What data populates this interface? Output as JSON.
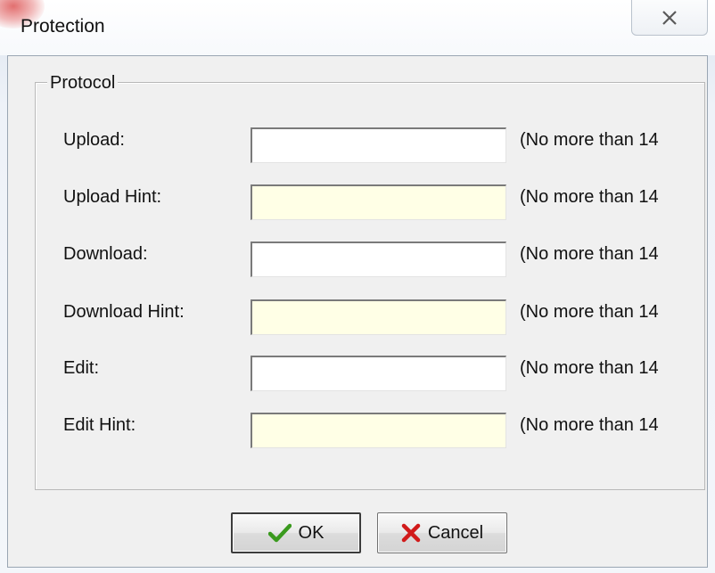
{
  "window": {
    "title": "Protection",
    "close_glyph": "✕"
  },
  "group": {
    "title": "Protocol"
  },
  "rows": [
    {
      "label": "Upload:",
      "value": "",
      "note": "(No more than 14"
    },
    {
      "label": "Upload Hint:",
      "value": "",
      "note": "(No more than 14"
    },
    {
      "label": "Download:",
      "value": "",
      "note": "(No more than 14"
    },
    {
      "label": "Download Hint:",
      "value": "",
      "note": "(No more than 14"
    },
    {
      "label": "Edit:",
      "value": "",
      "note": "(No more than 14"
    },
    {
      "label": "Edit Hint:",
      "value": "",
      "note": "(No more than 14"
    }
  ],
  "buttons": {
    "ok_label": "OK",
    "ok_icon": "checkmark-icon",
    "cancel_label": "Cancel",
    "cancel_icon": "x-mark-icon"
  },
  "colors": {
    "hint_field_bg": "#ffffe6",
    "ok_icon": "#3a9a1e",
    "cancel_icon": "#d11a1a"
  }
}
